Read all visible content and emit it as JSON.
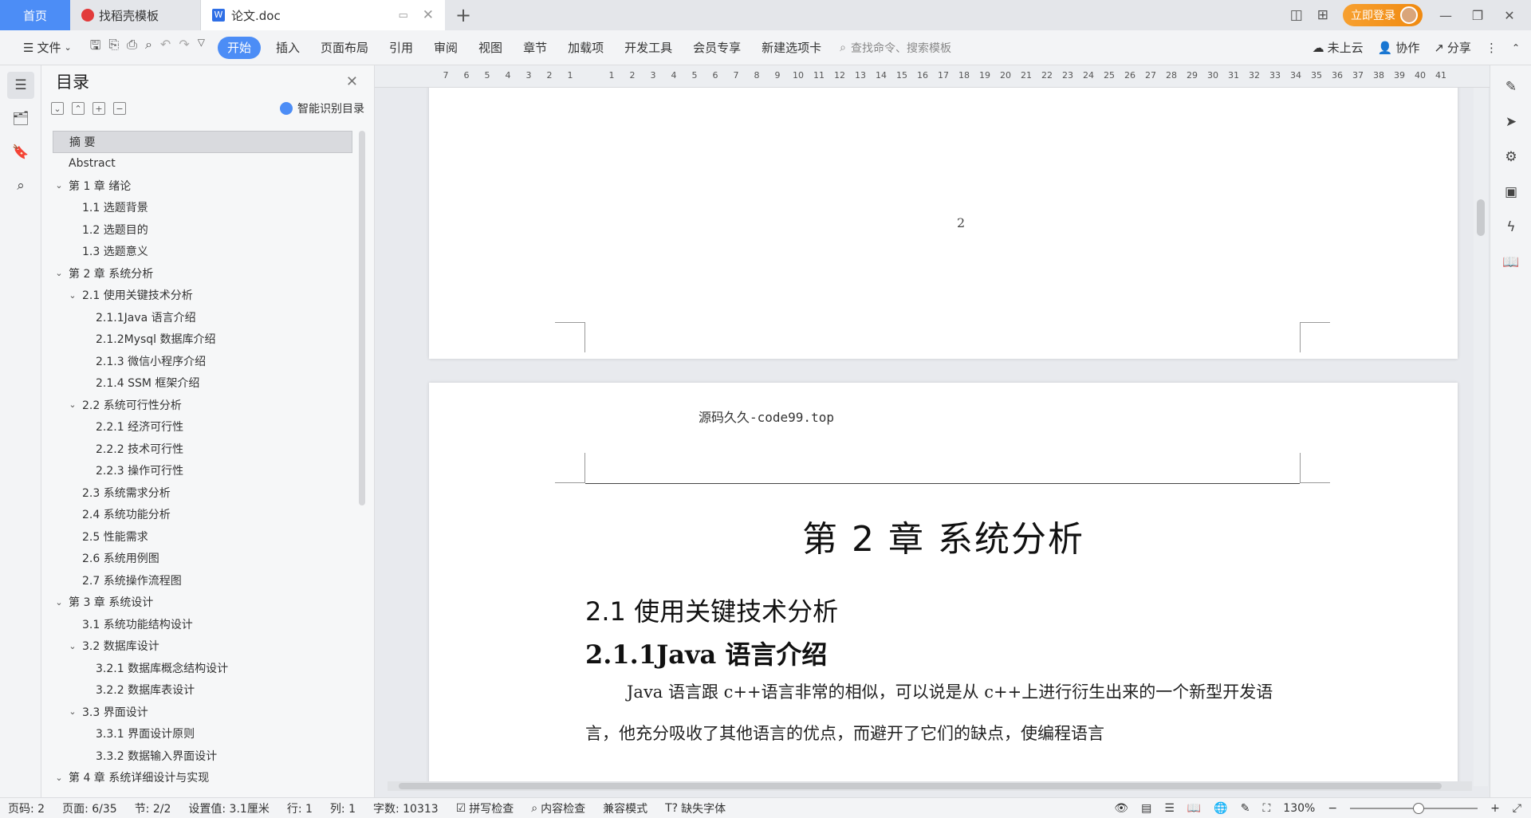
{
  "tabs": {
    "home": "首页",
    "template": "找稻壳模板",
    "document": "论文.doc"
  },
  "title_right": {
    "login": "立即登录"
  },
  "toolbar": {
    "file": "文件",
    "items": [
      "开始",
      "插入",
      "页面布局",
      "引用",
      "审阅",
      "视图",
      "章节",
      "加载项",
      "开发工具",
      "会员专享",
      "新建选项卡"
    ],
    "search_placeholder": "查找命令、搜索模板",
    "cloud": "未上云",
    "collab": "协作",
    "share": "分享"
  },
  "toc": {
    "title": "目录",
    "smart_label": "智能识别目录",
    "items": [
      {
        "label": "摘  要",
        "level": 0,
        "toggle": ""
      },
      {
        "label": "Abstract",
        "level": 0,
        "toggle": ""
      },
      {
        "label": "第 1 章   绪论",
        "level": 0,
        "toggle": "v"
      },
      {
        "label": "1.1 选题背景",
        "level": 1,
        "toggle": ""
      },
      {
        "label": "1.2 选题目的",
        "level": 1,
        "toggle": ""
      },
      {
        "label": "1.3 选题意义",
        "level": 1,
        "toggle": ""
      },
      {
        "label": "第 2 章  系统分析",
        "level": 0,
        "toggle": "v"
      },
      {
        "label": "2.1 使用关键技术分析",
        "level": 1,
        "toggle": "v"
      },
      {
        "label": "2.1.1Java 语言介绍",
        "level": 2,
        "toggle": ""
      },
      {
        "label": " 2.1.2Mysql 数据库介绍",
        "level": 2,
        "toggle": ""
      },
      {
        "label": "2.1.3 微信小程序介绍",
        "level": 2,
        "toggle": ""
      },
      {
        "label": "2.1.4 SSM 框架介绍",
        "level": 2,
        "toggle": ""
      },
      {
        "label": "2.2 系统可行性分析",
        "level": 1,
        "toggle": "v"
      },
      {
        "label": "2.2.1 经济可行性",
        "level": 2,
        "toggle": ""
      },
      {
        "label": "2.2.2 技术可行性",
        "level": 2,
        "toggle": ""
      },
      {
        "label": "2.2.3 操作可行性",
        "level": 2,
        "toggle": ""
      },
      {
        "label": "2.3 系统需求分析",
        "level": 1,
        "toggle": ""
      },
      {
        "label": "2.4 系统功能分析",
        "level": 1,
        "toggle": ""
      },
      {
        "label": "2.5 性能需求",
        "level": 1,
        "toggle": ""
      },
      {
        "label": "2.6 系统用例图",
        "level": 1,
        "toggle": ""
      },
      {
        "label": "2.7 系统操作流程图",
        "level": 1,
        "toggle": ""
      },
      {
        "label": "第 3 章  系统设计",
        "level": 0,
        "toggle": "v"
      },
      {
        "label": "3.1 系统功能结构设计",
        "level": 1,
        "toggle": ""
      },
      {
        "label": "3.2 数据库设计",
        "level": 1,
        "toggle": "v"
      },
      {
        "label": "3.2.1 数据库概念结构设计",
        "level": 2,
        "toggle": ""
      },
      {
        "label": "3.2.2 数据库表设计",
        "level": 2,
        "toggle": ""
      },
      {
        "label": "3.3 界面设计",
        "level": 1,
        "toggle": "v"
      },
      {
        "label": "3.3.1 界面设计原则",
        "level": 2,
        "toggle": ""
      },
      {
        "label": "3.3.2 数据输入界面设计",
        "level": 2,
        "toggle": ""
      },
      {
        "label": "第 4 章  系统详细设计与实现",
        "level": 0,
        "toggle": "v"
      }
    ]
  },
  "ruler": [
    "7",
    "6",
    "5",
    "4",
    "3",
    "2",
    "1",
    "",
    "1",
    "2",
    "3",
    "4",
    "5",
    "6",
    "7",
    "8",
    "9",
    "10",
    "11",
    "12",
    "13",
    "14",
    "15",
    "16",
    "17",
    "18",
    "19",
    "20",
    "21",
    "22",
    "23",
    "24",
    "25",
    "26",
    "27",
    "28",
    "29",
    "30",
    "31",
    "32",
    "33",
    "34",
    "35",
    "36",
    "37",
    "38",
    "39",
    "40",
    "41"
  ],
  "document": {
    "page_number": "2",
    "header_text": "源码久久-code99.top",
    "chapter_title": "第 2 章  系统分析",
    "section_title": "2.1 使用关键技术分析",
    "subsection_title": "2.1.1Java 语言介绍",
    "paragraph": "Java 语言跟 c++语言非常的相似，可以说是从 c++上进行衍生出来的一个新型开发语言，他充分吸收了其他语言的优点，而避开了它们的缺点，使编程语言"
  },
  "status": {
    "page": "页码: 2",
    "pages": "页面: 6/35",
    "section": "节: 2/2",
    "setting": "设置值: 3.1厘米",
    "row": "行: 1",
    "col": "列: 1",
    "wordcount": "字数: 10313",
    "spell": "拼写检查",
    "content_check": "内容检查",
    "compat": "兼容模式",
    "missing_font": "缺失字体",
    "zoom": "130%",
    "zoom_level": 0.54
  },
  "colors": {
    "accent": "#4c8df6",
    "login": "#f08a10"
  }
}
